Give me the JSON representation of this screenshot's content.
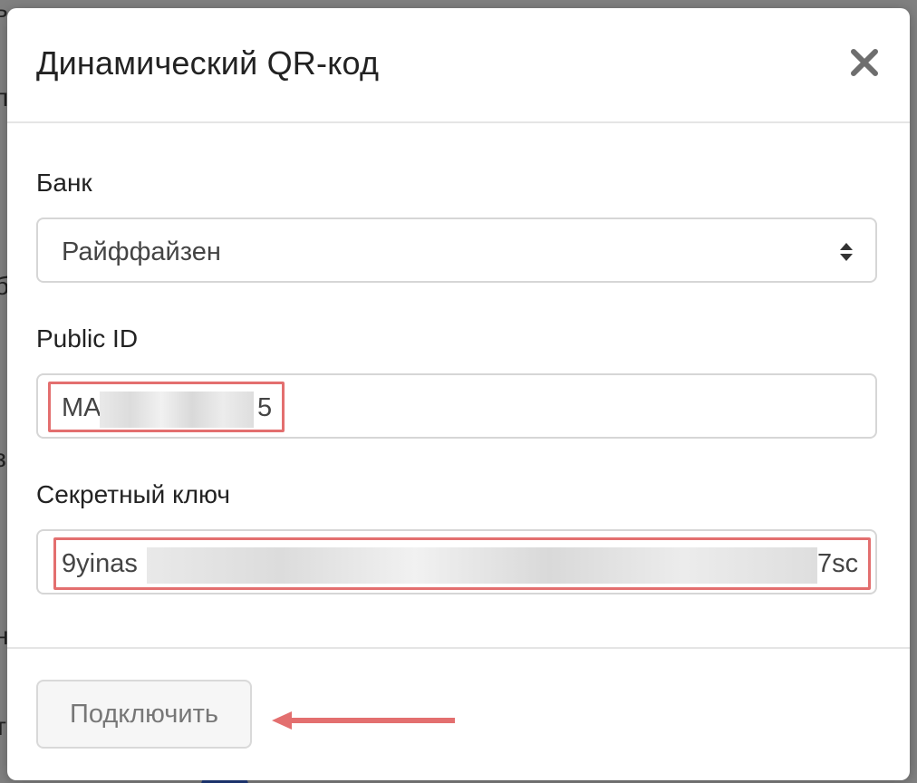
{
  "modal": {
    "title": "Динамический QR-код",
    "close_icon": "close-icon"
  },
  "bank": {
    "label": "Банк",
    "selected": "Райффайзен",
    "icon": "select-arrows-icon"
  },
  "public_id": {
    "label": "Public ID",
    "value_start": "MA",
    "value_end": "5",
    "redacted": true
  },
  "secret_key": {
    "label": "Секретный ключ",
    "value_start": "9yinas",
    "value_end": "7sc",
    "redacted": true
  },
  "footer": {
    "connect_label": "Подключить"
  },
  "annotations": {
    "highlight_color": "#e36f6f",
    "arrow_icon": "pointer-arrow-icon"
  },
  "colors": {
    "overlay": "#808080",
    "text": "#222222",
    "muted_text": "#777777",
    "border": "#d6d6d6"
  }
}
